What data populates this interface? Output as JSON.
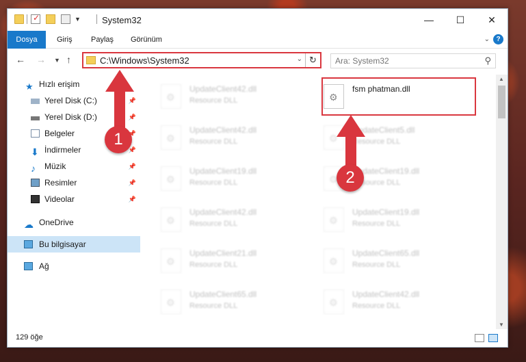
{
  "window": {
    "title": "System32"
  },
  "ribbon": {
    "tabs": [
      "Dosya",
      "Giriş",
      "Paylaş",
      "Görünüm"
    ],
    "help": "?"
  },
  "address": {
    "path": "C:\\Windows\\System32"
  },
  "search": {
    "placeholder": "Ara: System32"
  },
  "sidebar": {
    "items": [
      {
        "label": "Hızlı erişim",
        "icon": "star-icon",
        "pinned": false
      },
      {
        "label": "Yerel Disk (C:)",
        "icon": "disk-icon",
        "pinned": true
      },
      {
        "label": "Yerel Disk (D:)",
        "icon": "disk-icon",
        "pinned": true
      },
      {
        "label": "Belgeler",
        "icon": "documents-icon",
        "pinned": true
      },
      {
        "label": "İndirmeler",
        "icon": "download-icon",
        "pinned": true
      },
      {
        "label": "Müzik",
        "icon": "music-icon",
        "pinned": true
      },
      {
        "label": "Resimler",
        "icon": "pictures-icon",
        "pinned": true
      },
      {
        "label": "Videolar",
        "icon": "video-icon",
        "pinned": true
      },
      {
        "label": "OneDrive",
        "icon": "cloud-icon",
        "pinned": false
      },
      {
        "label": "Bu bilgisayar",
        "icon": "computer-icon",
        "pinned": false,
        "selected": true
      },
      {
        "label": "Ağ",
        "icon": "network-icon",
        "pinned": false
      }
    ]
  },
  "files": {
    "left_column": [
      {
        "name": "UpdateClient42.dll",
        "type": "Resource DLL"
      },
      {
        "name": "UpdateClient42.dll",
        "type": "Resource DLL"
      },
      {
        "name": "UpdateClient19.dll",
        "type": "Resource DLL"
      },
      {
        "name": "UpdateClient42.dll",
        "type": "Resource DLL"
      },
      {
        "name": "UpdateClient21.dll",
        "type": "Resource DLL"
      },
      {
        "name": "UpdateClient65.dll",
        "type": "Resource DLL"
      }
    ],
    "right_column": [
      {
        "name": "fsm phatman.dll",
        "type": ""
      },
      {
        "name": "UpdateClient5.dll",
        "type": "Resource DLL"
      },
      {
        "name": "UpdateClient19.dll",
        "type": "Resource DLL"
      },
      {
        "name": "UpdateClient19.dll",
        "type": "Resource DLL"
      },
      {
        "name": "UpdateClient65.dll",
        "type": "Resource DLL"
      },
      {
        "name": "UpdateClient42.dll",
        "type": "Resource DLL"
      }
    ]
  },
  "status": {
    "count": "129 öğe"
  },
  "annotations": {
    "step1": "1",
    "step2": "2"
  },
  "colors": {
    "accent": "#1979ca",
    "annotation": "#d9363e",
    "selection": "#cce4f7"
  }
}
